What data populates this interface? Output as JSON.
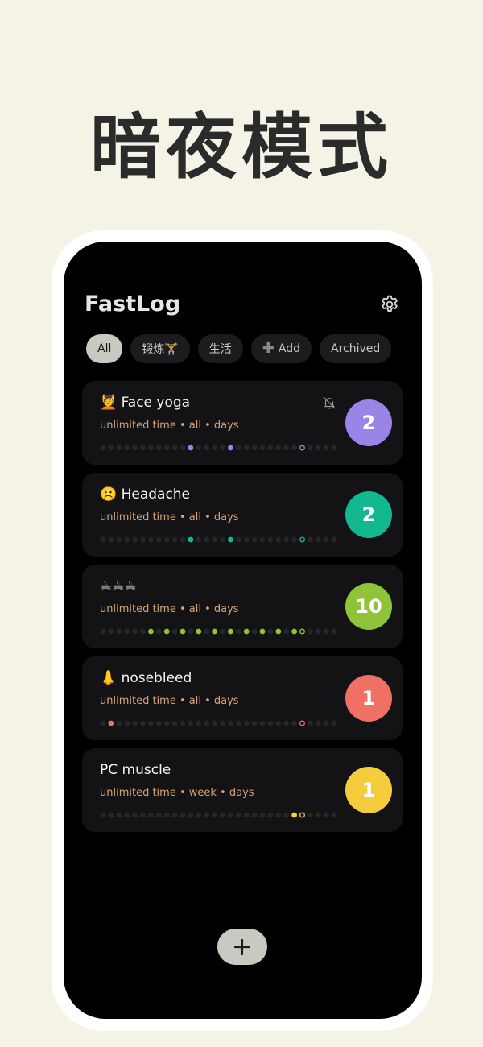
{
  "banner": {
    "title": "暗夜模式"
  },
  "app": {
    "title": "FastLog"
  },
  "tabs": [
    {
      "label": "All",
      "active": true
    },
    {
      "label": "锻炼🏋",
      "active": false
    },
    {
      "label": "生活",
      "active": false
    },
    {
      "label": "Add",
      "active": false,
      "icon": "plus-icon"
    },
    {
      "label": "Archived",
      "active": false
    }
  ],
  "cards": [
    {
      "name": "💆 Face yoga",
      "meta": "unlimited time • all • days",
      "count": "2",
      "color": "#9b84e8",
      "reminder": true,
      "filled_dots": [
        11,
        16
      ],
      "open_dot": 25
    },
    {
      "name": "☹️ Headache",
      "meta": "unlimited time • all • days",
      "count": "2",
      "color": "#12b890",
      "reminder": false,
      "filled_dots": [
        11,
        16
      ],
      "open_dot": 25
    },
    {
      "name": "☕☕☕",
      "meta": "unlimited time • all • days",
      "count": "10",
      "color": "#8fc43a",
      "reminder": false,
      "filled_dots": [
        6,
        8,
        10,
        12,
        14,
        16,
        18,
        20,
        22,
        24
      ],
      "open_dot": 25
    },
    {
      "name": "👃 nosebleed",
      "meta": "unlimited time • all • days",
      "count": "1",
      "color": "#f07064",
      "reminder": false,
      "filled_dots": [
        1
      ],
      "open_dot": 25
    },
    {
      "name": "PC muscle",
      "meta": "unlimited time • week • days",
      "count": "1",
      "color": "#f5cd3c",
      "reminder": false,
      "filled_dots": [
        24
      ],
      "open_dot": 25
    }
  ],
  "colors": {
    "background": "#f5f3e6",
    "screen": "#000000",
    "card": "#131316",
    "meta_text": "#d8a374"
  }
}
